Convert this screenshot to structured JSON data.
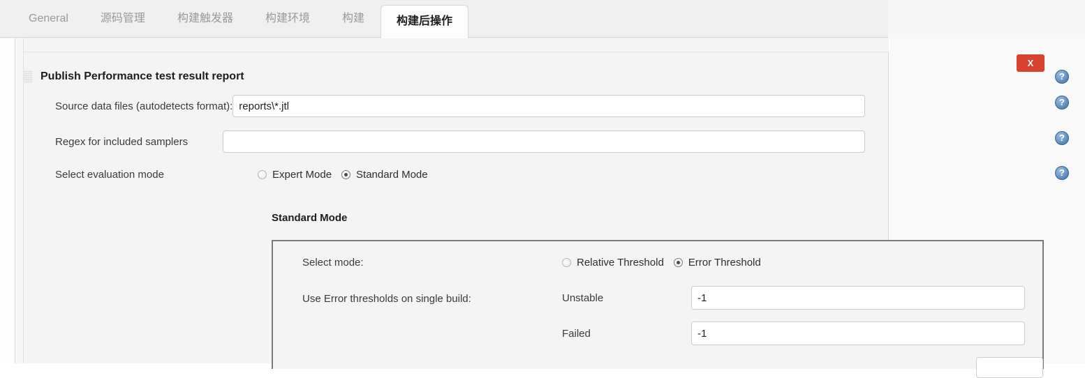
{
  "tabs": [
    {
      "label": "General",
      "active": false
    },
    {
      "label": "源码管理",
      "active": false
    },
    {
      "label": "构建触发器",
      "active": false
    },
    {
      "label": "构建环境",
      "active": false
    },
    {
      "label": "构建",
      "active": false
    },
    {
      "label": "构建后操作",
      "active": true
    }
  ],
  "section": {
    "title": "Publish Performance test result report",
    "drag_handle_icon": "drag-grip-icon",
    "delete_label": "X"
  },
  "fields": {
    "source_data_files": {
      "label": "Source data files (autodetects format):",
      "value": "reports\\*.jtl",
      "placeholder": ""
    },
    "regex_included_samplers": {
      "label": "Regex for included samplers",
      "value": "",
      "placeholder": ""
    },
    "evaluation_mode": {
      "label": "Select evaluation mode",
      "options": [
        {
          "label": "Expert Mode",
          "checked": false
        },
        {
          "label": "Standard Mode",
          "checked": true
        }
      ]
    }
  },
  "standard_mode": {
    "title": "Standard Mode",
    "select_mode": {
      "label": "Select mode:",
      "options": [
        {
          "label": "Relative Threshold",
          "checked": false
        },
        {
          "label": "Error Threshold",
          "checked": true
        }
      ]
    },
    "error_thresholds": {
      "caption": "Use Error thresholds on single build:",
      "rows": [
        {
          "name": "Unstable",
          "value": "-1"
        },
        {
          "name": "Failed",
          "value": "-1"
        }
      ]
    }
  },
  "help_icons": [
    {
      "name": "help-icon-section"
    },
    {
      "name": "help-icon-source-data-files"
    },
    {
      "name": "help-icon-regex-samplers"
    },
    {
      "name": "help-icon-evaluation-mode"
    }
  ],
  "colors": {
    "accent_delete": "#d9422f",
    "help_blue": "#3f6f9f",
    "page_background": "#f4f4f4",
    "box_border": "#7a7a7a"
  }
}
